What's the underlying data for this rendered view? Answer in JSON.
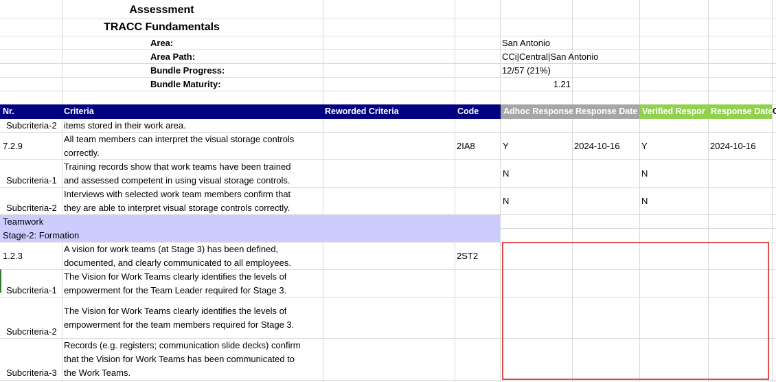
{
  "title": {
    "assessment": "Assessment",
    "module": "TRACC Fundamentals"
  },
  "meta": [
    {
      "label": "Area:",
      "value": "San Antonio"
    },
    {
      "label": "Area Path:",
      "value": "CCi|Central|San Antonio"
    },
    {
      "label": "Bundle Progress:",
      "value": "12/57 (21%)"
    },
    {
      "label": "Bundle Maturity:",
      "value": "1.21"
    }
  ],
  "headers": {
    "nr": "Nr.",
    "criteria": "Criteria",
    "reworded": "Reworded Criteria",
    "code": "Code",
    "adhoc_response": "Adhoc Response",
    "adhoc_date": "Response Date",
    "verified_response": "Verified Respor",
    "verified_date": "Response Date",
    "overflow": "C"
  },
  "colors": {
    "header_navy": "#000080",
    "header_gray": "#a6a6a6",
    "header_green": "#92d050",
    "section_band": "#ccccff",
    "highlight_box": "#e04b4b"
  },
  "rows": [
    {
      "nr": "Subcriteria-2",
      "criteria": [
        "items stored in their work area."
      ],
      "code": "",
      "adhoc": "",
      "adhoc_date": "",
      "verified": "",
      "verified_date": ""
    },
    {
      "nr": "7.2.9",
      "criteria": [
        "All team members can interpret the visual storage controls",
        "correctly."
      ],
      "code": "2IA8",
      "adhoc": "Y",
      "adhoc_date": "2024-10-16",
      "verified": "Y",
      "verified_date": "2024-10-16"
    },
    {
      "nr": "Subcriteria-1",
      "criteria": [
        "Training records show that work teams have been trained",
        "and assessed competent in using visual storage controls."
      ],
      "code": "",
      "adhoc": "N",
      "adhoc_date": "",
      "verified": "N",
      "verified_date": ""
    },
    {
      "nr": "Subcriteria-2",
      "criteria": [
        "Interviews with selected work team members confirm that",
        "they are able to interpret visual storage controls correctly."
      ],
      "code": "",
      "adhoc": "N",
      "adhoc_date": "",
      "verified": "N",
      "verified_date": ""
    }
  ],
  "section": {
    "topic": "Teamwork",
    "stage": "Stage-2: Formation"
  },
  "rows2": [
    {
      "nr": "1.2.3",
      "criteria": [
        "A vision for work teams (at Stage 3) has been defined,",
        "documented, and clearly communicated to all employees."
      ],
      "code": "2ST2"
    },
    {
      "nr": "Subcriteria-1",
      "criteria": [
        "The Vision for Work Teams clearly identifies the levels of",
        "empowerment for the Team Leader required for Stage 3."
      ],
      "code": ""
    },
    {
      "nr": "Subcriteria-2",
      "criteria": [
        "The Vision for Work Teams clearly identifies the levels of",
        "empowerment for the team members required for Stage 3."
      ],
      "code": ""
    },
    {
      "nr": "Subcriteria-3",
      "criteria": [
        "Records (e.g. registers; communication slide decks) confirm",
        "that the Vision for Work Teams has been communicated to",
        "the Work Teams."
      ],
      "code": ""
    }
  ]
}
